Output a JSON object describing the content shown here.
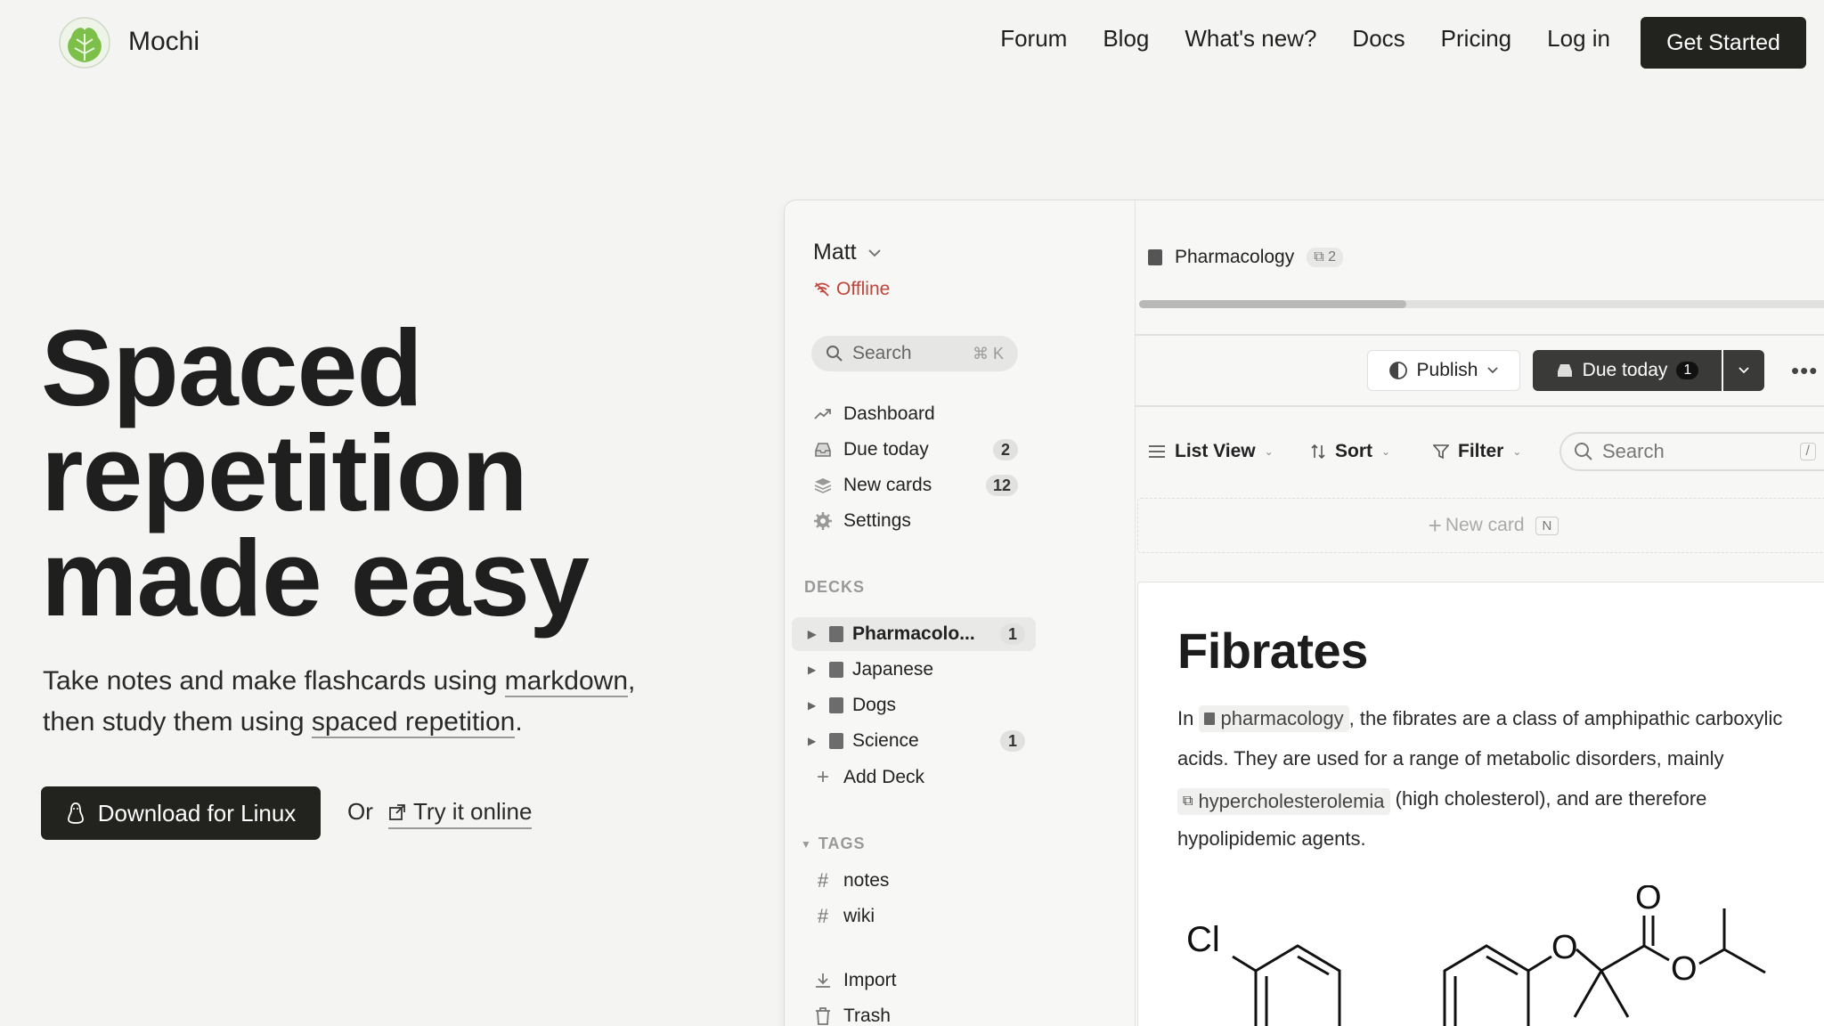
{
  "nav": {
    "brand": "Mochi",
    "links": [
      "Forum",
      "Blog",
      "What's new?",
      "Docs",
      "Pricing",
      "Log in"
    ],
    "cta": "Get Started"
  },
  "hero": {
    "title_lines": [
      "Spaced",
      "repetition",
      "made easy"
    ],
    "sub_1": "Take notes and make flashcards using ",
    "sub_link1": "markdown",
    "sub_2": ",",
    "sub_3": "then study them using ",
    "sub_link2": "spaced repetition",
    "sub_4": ".",
    "download": "Download for Linux",
    "or": "Or",
    "try": "Try it online"
  },
  "sidebar": {
    "user": "Matt",
    "status": "Offline",
    "search_placeholder": "Search",
    "search_kbd": "⌘ K",
    "items": [
      {
        "label": "Dashboard",
        "icon": "trend-icon"
      },
      {
        "label": "Due today",
        "icon": "inbox-icon",
        "badge": "2"
      },
      {
        "label": "New cards",
        "icon": "layers-icon",
        "badge": "12"
      },
      {
        "label": "Settings",
        "icon": "gear-icon"
      }
    ],
    "decks_label": "DECKS",
    "decks": [
      {
        "label": "Pharmacolo...",
        "badge": "1"
      },
      {
        "label": "Japanese"
      },
      {
        "label": "Dogs"
      },
      {
        "label": "Science",
        "badge": "1"
      }
    ],
    "add_deck": "Add Deck",
    "tags_label": "TAGS",
    "tags": [
      "notes",
      "wiki"
    ],
    "import": "Import",
    "trash": "Trash"
  },
  "main": {
    "deck_title": "Pharmacology",
    "deck_count": "2",
    "progress": 0.38,
    "publish": "Publish",
    "due_today": "Due today",
    "due_count": "1",
    "list_view": "List View",
    "sort": "Sort",
    "filter": "Filter",
    "search_placeholder": "Search",
    "search_kbd": "/",
    "new_card": "New card",
    "new_card_key": "N",
    "card": {
      "title": "Fibrates",
      "p1": "In ",
      "chip1": "pharmacology",
      "p2": ", the fibrates are a class of amphipathic carboxylic acids. They are used for a range of metabolic disorders, mainly ",
      "chip2": "hypercholesterolemia",
      "p3": " (high cholesterol), and are therefore hypolipidemic agents.",
      "chem_cl": "Cl",
      "chem_o1": "O",
      "chem_o2": "O",
      "chem_o3": "O"
    }
  }
}
